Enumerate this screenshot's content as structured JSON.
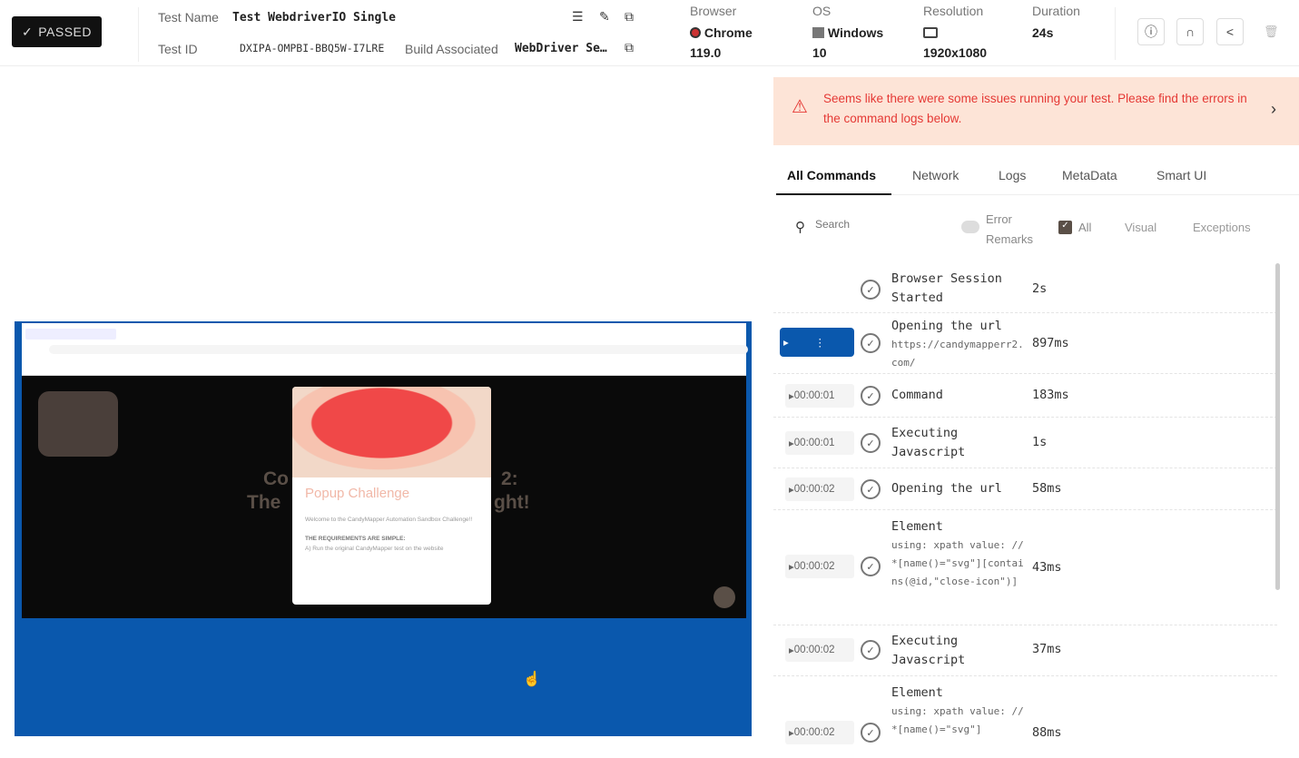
{
  "header": {
    "status": "PASSED",
    "test_name_label": "Test Name",
    "test_name": "Test WebdriverIO Single",
    "test_id_label": "Test ID",
    "test_id": "DXIPA-OMPBI-BBQ5W-I7LRE",
    "build_label": "Build Associated",
    "build": "WebDriver Se…",
    "browser_label": "Browser",
    "browser": "Chrome",
    "browser_version": "119.0",
    "os_label": "OS",
    "os": "Windows",
    "os_version": "10",
    "resolution_label": "Resolution",
    "resolution": "1920x1080",
    "duration_label": "Duration",
    "duration": "24s"
  },
  "video": {
    "popup_title": "Popup Challenge",
    "popup_text": "Welcome to the CandyMapper Automation Sandbox Challenge!!",
    "popup_req": "THE REQUIREMENTS ARE SIMPLE:",
    "popup_item": "A) Run the original CandyMapper test on the website",
    "headline_1a": "Co",
    "headline_1b": "2:",
    "headline_2a": "The",
    "headline_2b": "ght!"
  },
  "alert": {
    "message": "Seems like there were some issues running your test. Please find the errors in the command logs below."
  },
  "tabs": [
    "All Commands",
    "Network",
    "Logs",
    "MetaData",
    "Smart UI"
  ],
  "filters": {
    "search_placeholder": "Search",
    "error_remarks": "Error Remarks",
    "all": "All",
    "visual": "Visual",
    "exceptions": "Exceptions"
  },
  "commands": [
    {
      "time": "",
      "name": "Browser Session Started",
      "detail": "",
      "duration": "2s"
    },
    {
      "time": "",
      "name": "Opening the url",
      "detail": "https://candymapperr2.com/",
      "duration": "897ms"
    },
    {
      "time": "00:00:01",
      "name": "Command",
      "detail": "",
      "duration": "183ms"
    },
    {
      "time": "00:00:01",
      "name": "Executing Javascript",
      "detail": "",
      "duration": "1s"
    },
    {
      "time": "00:00:02",
      "name": "Opening the url",
      "detail": "",
      "duration": "58ms"
    },
    {
      "time": "00:00:02",
      "name": "Element",
      "detail": "using: xpath value: //*[name()=\"svg\"][contains(@id,\"close-icon\")]",
      "duration": "43ms"
    },
    {
      "time": "00:00:02",
      "name": "Executing Javascript",
      "detail": "",
      "duration": "37ms"
    },
    {
      "time": "00:00:02",
      "name": "Element",
      "detail": "using: xpath value: //*[name()=\"svg\"]",
      "duration": "88ms"
    }
  ]
}
